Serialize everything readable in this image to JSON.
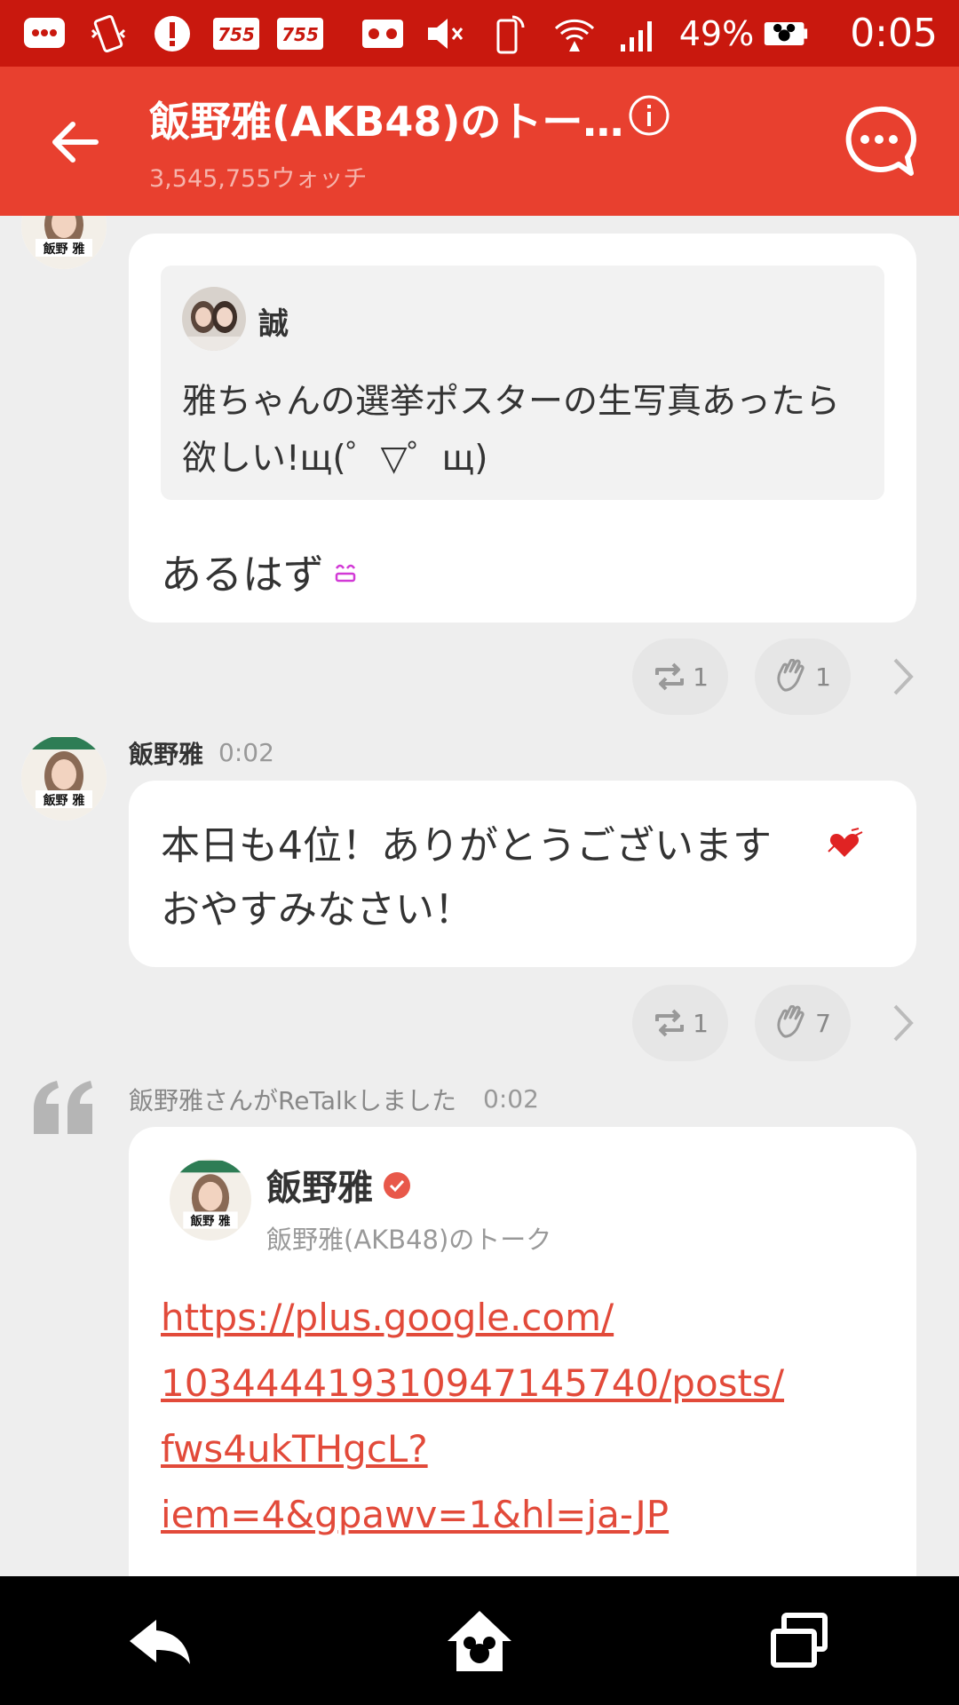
{
  "status_bar": {
    "battery": "49%",
    "time": "0:05",
    "icons": [
      "chat-bubble-icon",
      "vibrate-icon",
      "alert-icon",
      "app-755-icon",
      "app-755-icon",
      "voicemail-icon",
      "mute-icon",
      "nfc-phone-icon",
      "wifi-icon",
      "signal-icon",
      "battery-icon"
    ]
  },
  "app_bar": {
    "title": "飯野雅(AKB48)のトー…",
    "subtitle": "3,545,755ウォッチ",
    "color": "#e8402f"
  },
  "posts": [
    {
      "quote": {
        "name": "誠",
        "text": "雅ちゃんの選挙ポスターの生写真あったら欲しい!щ(゜▽゜щ)"
      },
      "reply": "あるはず",
      "retalk_count": "1",
      "like_count": "1"
    },
    {
      "author": "飯野雅",
      "time": "0:02",
      "text": "本日も4位！ありがとうございます\nおやすみなさい！",
      "retalk_count": "1",
      "like_count": "7"
    },
    {
      "retalk_label": "飯野雅さんがReTalkしました",
      "time": "0:02",
      "card_name": "飯野雅",
      "card_sub": "飯野雅(AKB48)のトーク",
      "link": "https://plus.google.com/\n103444419310947145740/posts/\nfws4ukTHgcL?\niem=4&gpawv=1&hl=ja-JP"
    }
  ],
  "accent_link_color": "#e24a3a"
}
